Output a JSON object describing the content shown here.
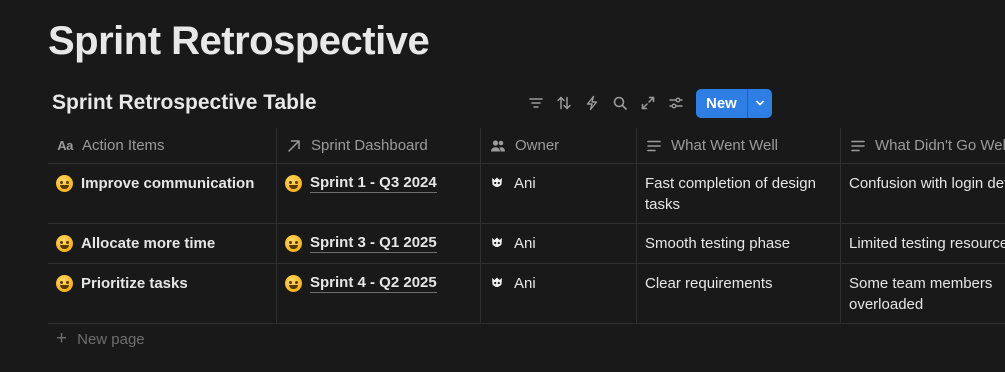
{
  "page": {
    "title": "Sprint Retrospective"
  },
  "database": {
    "title": "Sprint Retrospective Table",
    "toolbar": {
      "icons": [
        "filter-icon",
        "sort-icon",
        "automation-icon",
        "search-icon",
        "expand-icon",
        "settings-icon"
      ],
      "new_label": "New",
      "accent": "#2f7ee3"
    },
    "columns": [
      {
        "label": "Action Items",
        "icon": "title-property-icon"
      },
      {
        "label": "Sprint Dashboard",
        "icon": "relation-arrow-icon"
      },
      {
        "label": "Owner",
        "icon": "people-icon"
      },
      {
        "label": "What Went Well",
        "icon": "text-property-icon"
      },
      {
        "label": "What Didn't Go Well",
        "icon": "text-property-icon"
      }
    ],
    "rows": [
      {
        "action": "Improve communication",
        "sprint": "Sprint 1 - Q3 2024",
        "owner": "Ani",
        "went_well": "Fast completion of design tasks",
        "didnt_go_well": "Confusion with login details"
      },
      {
        "action": "Allocate more time",
        "sprint": "Sprint 3 - Q1 2025",
        "owner": "Ani",
        "went_well": "Smooth testing phase",
        "didnt_go_well": "Limited testing resources"
      },
      {
        "action": "Prioritize tasks",
        "sprint": "Sprint 4 - Q2 2025",
        "owner": "Ani",
        "went_well": "Clear requirements",
        "didnt_go_well": "Some team members overloaded"
      }
    ],
    "new_page_label": "New page"
  }
}
